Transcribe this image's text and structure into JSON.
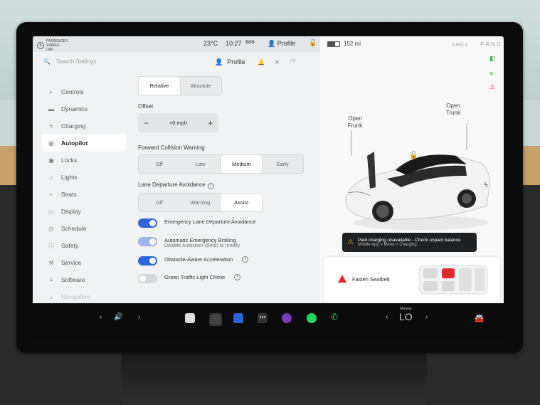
{
  "status_bar": {
    "passenger_airbag": "PASSENGER AIRBAG OFF",
    "temperature": "23°C",
    "time": "10:27",
    "sos": "SOS",
    "profile": "Profile"
  },
  "settings_header": {
    "search_placeholder": "Search Settings",
    "profile_label": "Profile",
    "lte": "LTE"
  },
  "nav": {
    "items": [
      {
        "label": "Controls",
        "icon": "toggle-icon"
      },
      {
        "label": "Dynamics",
        "icon": "car-icon"
      },
      {
        "label": "Charging",
        "icon": "bolt-icon"
      },
      {
        "label": "Autopilot",
        "icon": "steering-wheel-icon",
        "active": true
      },
      {
        "label": "Locks",
        "icon": "lock-icon"
      },
      {
        "label": "Lights",
        "icon": "sun-icon"
      },
      {
        "label": "Seats",
        "icon": "seat-icon"
      },
      {
        "label": "Display",
        "icon": "display-icon"
      },
      {
        "label": "Schedule",
        "icon": "clock-icon"
      },
      {
        "label": "Safety",
        "icon": "info-icon"
      },
      {
        "label": "Service",
        "icon": "wrench-icon"
      },
      {
        "label": "Software",
        "icon": "download-icon"
      },
      {
        "label": "Navigation",
        "icon": "nav-arrow-icon"
      }
    ]
  },
  "autopilot": {
    "speed_mode": {
      "options": [
        "Relative",
        "Absolute"
      ],
      "selected": "Relative"
    },
    "offset": {
      "label": "Offset",
      "value": "+0 mph",
      "minus": "−",
      "plus": "+"
    },
    "fcw": {
      "label": "Forward Collision Warning",
      "options": [
        "Off",
        "Late",
        "Medium",
        "Early"
      ],
      "selected": "Medium"
    },
    "lda": {
      "label": "Lane Departure Avoidance",
      "options": [
        "Off",
        "Warning",
        "Assist"
      ],
      "selected": "Assist"
    },
    "toggles": [
      {
        "label": "Emergency Lane Departure Avoidance",
        "sub": "",
        "state": "on"
      },
      {
        "label": "Automatic Emergency Braking",
        "sub": "Disable Autosteer (Beta) to modify",
        "state": "dim"
      },
      {
        "label": "Obstacle-Aware Acceleration",
        "sub": "",
        "state": "on",
        "info": true
      },
      {
        "label": "Green Traffic Light Chime",
        "sub": "",
        "state": "off",
        "info": true
      }
    ]
  },
  "vehicle_panel": {
    "range": "152 mi",
    "drive_mode": "CHILL",
    "gear": "PRND",
    "open_frunk": "Open Frunk",
    "open_trunk": "Open Trunk",
    "charge_message": "Paid charging unavailable - Check unpaid balance",
    "charge_sub": "Mobile App > Menu > Charging",
    "seatbelt_alert": "Fasten Seatbelt",
    "colors": {
      "car_body": "#f2f2f2",
      "alert_red": "#e02b2b",
      "accent_blue": "#2b66d9",
      "green": "#3bb54a"
    }
  },
  "taskbar": {
    "volume_icon": "speaker-icon",
    "climate_label": "Manual",
    "climate_value": "LO",
    "apps": [
      "app-launcher-icon",
      "camera-icon",
      "rocket-icon",
      "more-icon",
      "media-icon",
      "spotify-icon",
      "phone-icon",
      "car-icon"
    ]
  }
}
